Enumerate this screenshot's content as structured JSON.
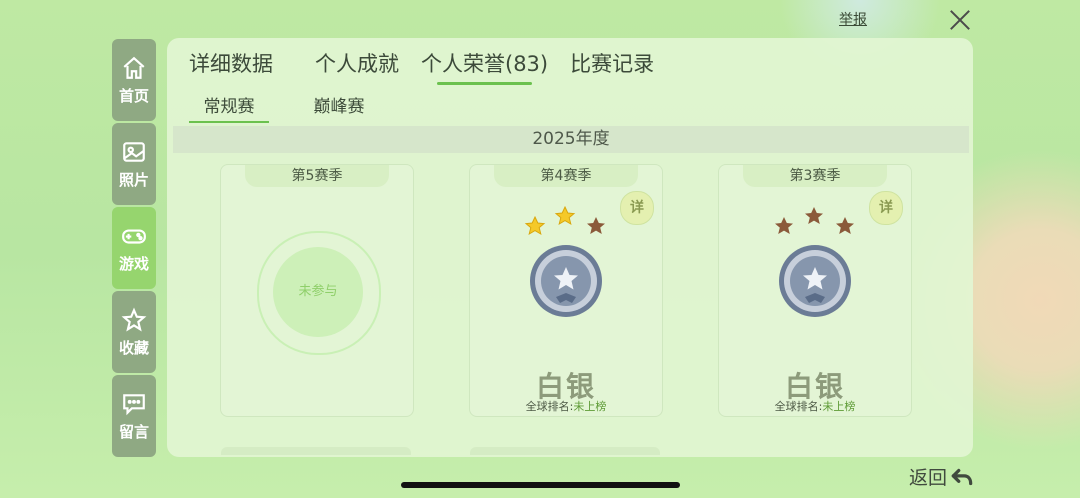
{
  "report_label": "举报",
  "nav": [
    {
      "label": "首页",
      "icon": "home-icon"
    },
    {
      "label": "照片",
      "icon": "photo-icon"
    },
    {
      "label": "游戏",
      "icon": "gamepad-icon",
      "active": true
    },
    {
      "label": "收藏",
      "icon": "star-icon"
    },
    {
      "label": "留言",
      "icon": "message-icon"
    }
  ],
  "tabs": [
    "详细数据",
    "个人成就",
    "个人荣誉(83)",
    "比赛记录"
  ],
  "active_tab": "个人荣誉(83)",
  "subtabs": [
    "常规赛",
    "巅峰赛"
  ],
  "active_subtab": "常规赛",
  "year_label": "2025年度",
  "cards": [
    {
      "season": "第5赛季",
      "status": "未参与"
    },
    {
      "season": "第4赛季",
      "detail_label": "详",
      "rank": "白银",
      "global_label": "全球排名:",
      "global_value": "未上榜",
      "gold_stars": 2,
      "total_stars": 3
    },
    {
      "season": "第3赛季",
      "detail_label": "详",
      "rank": "白银",
      "global_label": "全球排名:",
      "global_value": "未上榜",
      "gold_stars": 0,
      "total_stars": 3
    }
  ],
  "back_label": "返回",
  "colors": {
    "accent": "#6bc14e",
    "nav_bg": "#8fa983",
    "nav_active": "#96d56e",
    "gold_star": "#f5c928",
    "bronze_star": "#8b5a3a"
  }
}
